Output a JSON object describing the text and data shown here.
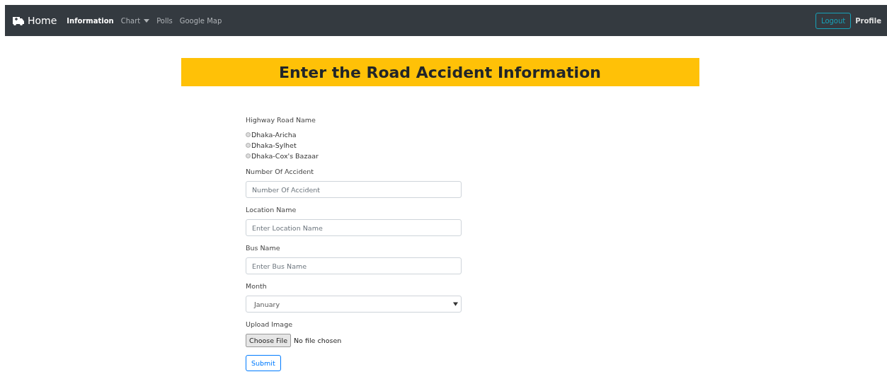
{
  "navbar": {
    "brand": "Home",
    "items": [
      {
        "label": "Information",
        "selected": true,
        "dropdown": false
      },
      {
        "label": "Chart",
        "selected": false,
        "dropdown": true
      },
      {
        "label": "Polls",
        "selected": false,
        "dropdown": false
      },
      {
        "label": "Google Map",
        "selected": false,
        "dropdown": false
      }
    ],
    "logout": "Logout",
    "profile": "Profile"
  },
  "heading": "Enter the Road Accident Information",
  "form": {
    "highway": {
      "label": "Highway Road Name",
      "options": [
        {
          "label": "Dhaka-Aricha",
          "selected": false
        },
        {
          "label": "Dhaka-Sylhet",
          "selected": false
        },
        {
          "label": "Dhaka-Cox's Bazaar",
          "selected": false
        }
      ]
    },
    "fields": [
      {
        "kind": "text",
        "label": "Number Of Accident",
        "placeholder": "Number Of Accident"
      },
      {
        "kind": "text",
        "label": "Location Name",
        "placeholder": "Enter Location Name"
      },
      {
        "kind": "text",
        "label": "Bus Name",
        "placeholder": "Enter Bus Name"
      },
      {
        "kind": "select",
        "label": "Month",
        "value": "January"
      },
      {
        "kind": "file",
        "label": "Upload Image",
        "button": "Choose File",
        "status": "No file chosen"
      }
    ],
    "submit": "Submit"
  }
}
